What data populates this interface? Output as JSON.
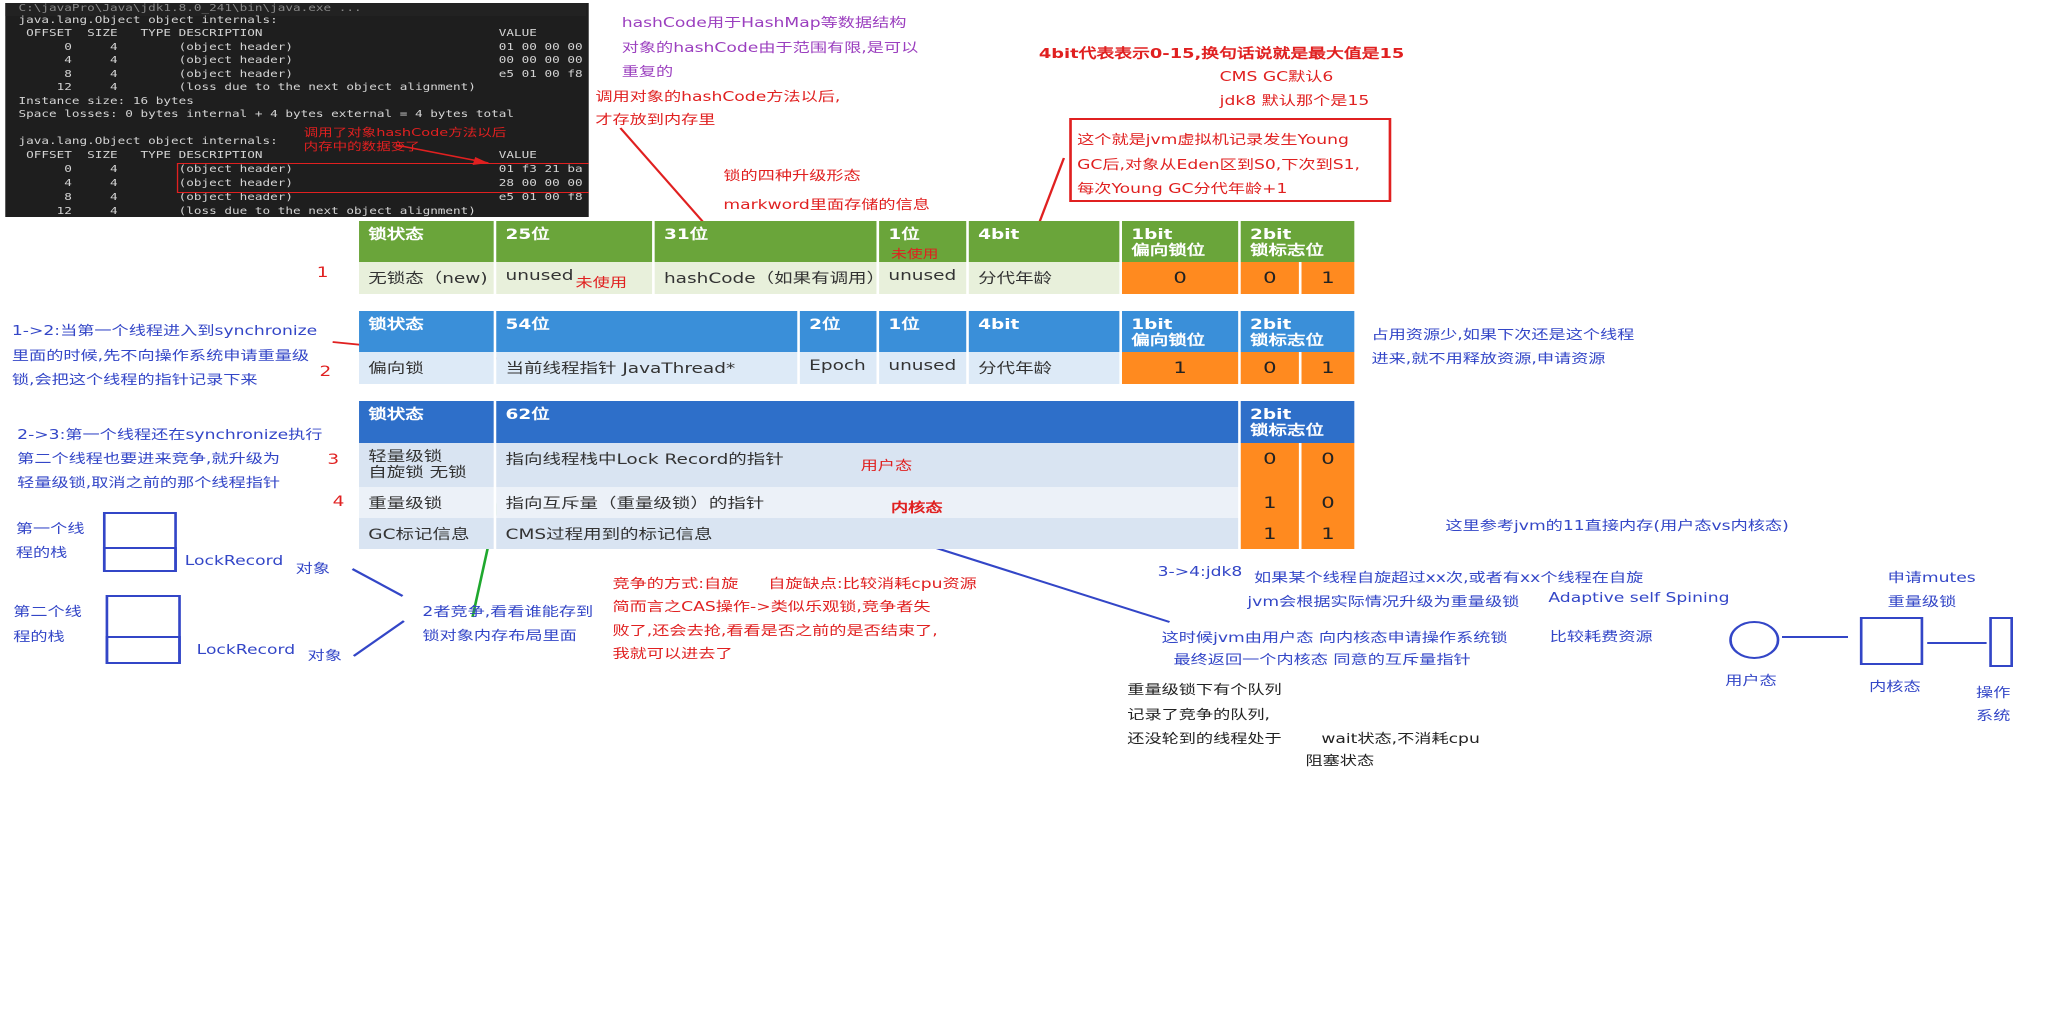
{
  "console": {
    "lines": [
      "C:\\javaPro\\Java\\jdk1.8.0_241\\bin\\java.exe ...",
      "java.lang.Object object internals:",
      " OFFSET  SIZE   TYPE DESCRIPTION                               VALUE",
      "      0     4        (object header)                           01 00 00 00",
      "      4     4        (object header)                           00 00 00 00",
      "      8     4        (object header)                           e5 01 00 f8",
      "     12     4        (loss due to the next object alignment)",
      "Instance size: 16 bytes",
      "Space losses: 0 bytes internal + 4 bytes external = 4 bytes total",
      "",
      "java.lang.Object object internals:",
      " OFFSET  SIZE   TYPE DESCRIPTION                               VALUE",
      "      0     4        (object header)                           01 f3 21 ba",
      "      4     4        (object header)                           28 00 00 00",
      "      8     4        (object header)                           e5 01 00 f8",
      "     12     4        (loss due to the next object alignment)"
    ],
    "annotation_line1": "调用了对象hashCode方法以后",
    "annotation_line2": "内存中的数据变了"
  },
  "notes": {
    "hashcode_1": "hashCode用于HashMap等数据结构",
    "hashcode_2": "对象的hashCode由于范围有限,是可以",
    "hashcode_3": "重复的",
    "hashcode_4": "调用对象的hashCode方法以后,",
    "hashcode_5": "才存放到内存里",
    "four_bit": "4bit代表表示0-15,换句话说就是最大值是15",
    "cms_default": "CMS GC默认6",
    "jdk8_default": "jdk8 默认那个是15",
    "young_1": "这个就是jvm虚拟机记录发生Young",
    "young_2": "GC后,对象从Eden区到S0,下次到S1,",
    "young_3": "每次Young GC分代年龄+1",
    "four_forms": "锁的四种升级形态",
    "markword": "markword里面存储的信息",
    "unused_note_1": "未使用",
    "unused_note_2": "未使用",
    "step12_1": "1->2:当第一个线程进入到synchronize",
    "step12_2": "里面的时候,先不向操作系统申请重量级",
    "step12_3": "锁,会把这个线程的指针记录下来",
    "biased_1": "占用资源少,如果下次还是这个线程",
    "biased_2": "进来,就不用释放资源,申请资源",
    "step23_1": "2->3:第一个线程还在synchronize执行",
    "step23_2": "第二个线程也要进来竞争,就升级为",
    "step23_3": "轻量级锁,取消之前的那个线程指针",
    "user_mode": "用户态",
    "kernel_mode": "内核态",
    "ref_jvm11": "这里参考jvm的11直接内存(用户态vs内核态)",
    "stack1_1": "第一个线",
    "stack1_2": "程的栈",
    "stack2_1": "第二个线",
    "stack2_2": "程的栈",
    "lockrecord1": "LockRecord",
    "object1": "对象",
    "lockrecord2": "LockRecord",
    "object2": "对象",
    "compete_1": "2者竞争,看看谁能存到",
    "compete_2": "锁对象内存布局里面",
    "spin_1": "竞争的方式:自旋",
    "spin_2": "自旋缺点:比较消耗cpu资源",
    "spin_3": "简而言之CAS操作->类似乐观锁,竞争者失",
    "spin_4": "败了,还会去抢,看看是否之前的是否结束了,",
    "spin_5": "我就可以进去了",
    "step34_1": "3->4:jdk8",
    "step34_2": "如果某个线程自旋超过xx次,或者有xx个线程在自旋",
    "step34_3": "jvm会根据实际情况升级为重量级锁",
    "step34_4": "Adaptive self Spining",
    "kernel_1": "这时候jvm由用户态 向内核态申请操作系统锁",
    "kernel_2": "最终返回一个内核态 同意的互斥量指针",
    "cost": "比较耗费资源",
    "mutex_1": "申请mutes",
    "mutex_2": "重量级锁",
    "queue_1": "重量级锁下有个队列",
    "queue_2": "记录了竞争的队列,",
    "queue_3": "还没轮到的线程处于",
    "queue_4": "wait状态,不消耗cpu",
    "queue_5": "阻塞状态",
    "flow_user": "用户态",
    "flow_kernel": "内核态",
    "flow_os_1": "操作",
    "flow_os_2": "系统"
  },
  "numbers": {
    "n1": "1",
    "n2": "2",
    "n3": "3",
    "n4": "4"
  },
  "table1": {
    "h_state": "锁状态",
    "h_25": "25位",
    "h_31": "31位",
    "h_1": "1位",
    "h_4bit": "4bit",
    "h_1bit_a": "1bit",
    "h_1bit_b": "偏向锁位",
    "h_2bit_a": "2bit",
    "h_2bit_b": "锁标志位",
    "r_state": "无锁态（new)",
    "r_25": "unused",
    "r_31": "hashCode（如果有调用）",
    "r_1": "unused",
    "r_age": "分代年龄",
    "v_bias": "0",
    "v_f1": "0",
    "v_f2": "1"
  },
  "table2": {
    "h_state": "锁状态",
    "h_54": "54位",
    "h_2": "2位",
    "h_1": "1位",
    "h_4bit": "4bit",
    "h_1bit_a": "1bit",
    "h_1bit_b": "偏向锁位",
    "h_2bit_a": "2bit",
    "h_2bit_b": "锁标志位",
    "r_state": "偏向锁",
    "r_54": "当前线程指针 JavaThread*",
    "r_2": "Epoch",
    "r_1": "unused",
    "r_age": "分代年龄",
    "v_bias": "1",
    "v_f1": "0",
    "v_f2": "1"
  },
  "table3": {
    "h_state": "锁状态",
    "h_62": "62位",
    "h_2bit_a": "2bit",
    "h_2bit_b": "锁标志位",
    "r1_state_a": "轻量级锁",
    "r1_state_b": "自旋锁 无锁",
    "r1_desc": "指向线程栈中Lock Record的指针",
    "r1_f1": "0",
    "r1_f2": "0",
    "r2_state": "重量级锁",
    "r2_desc": "指向互斥量（重量级锁）的指针",
    "r2_f1": "1",
    "r2_f2": "0",
    "r3_state": "GC标记信息",
    "r3_desc": "CMS过程用到的标记信息",
    "r3_f1": "1",
    "r3_f2": "1"
  }
}
